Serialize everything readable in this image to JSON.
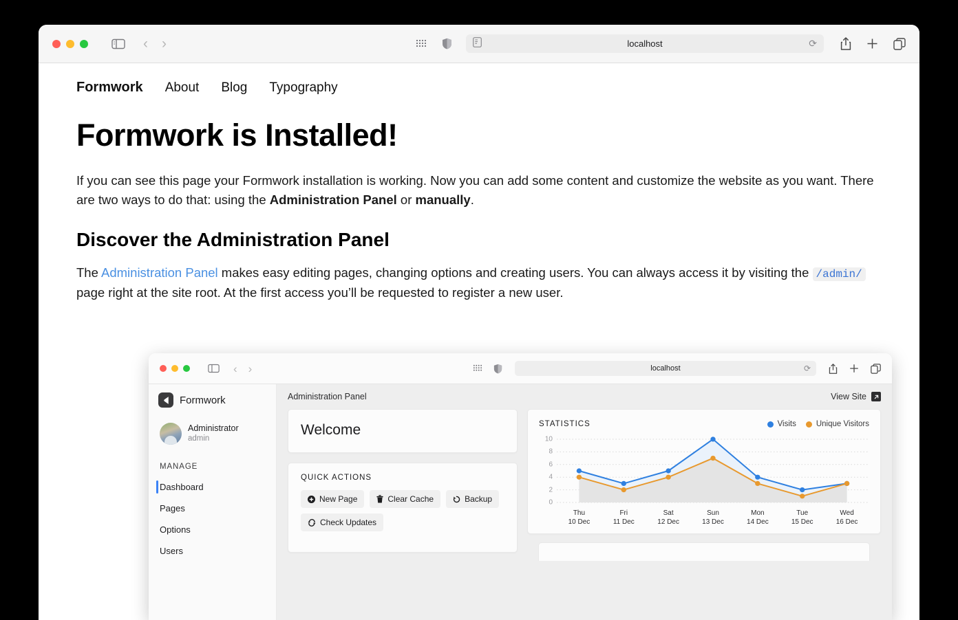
{
  "outer_browser": {
    "url": "localhost",
    "icons": {
      "sidebar": "sidebar-toggle-icon",
      "back": "‹",
      "forward": "›",
      "grid": "tab-grid-icon",
      "shield": "privacy-shield-icon",
      "reader": "reader-view-icon",
      "reload": "⟳",
      "share": "share-icon",
      "new_tab": "+",
      "tabs": "tab-overview-icon"
    }
  },
  "site_nav": {
    "brand": "Formwork",
    "items": [
      {
        "label": "About"
      },
      {
        "label": "Blog"
      },
      {
        "label": "Typography"
      }
    ]
  },
  "page": {
    "title": "Formwork is Installed!",
    "intro_part1": "If you can see this page your Formwork installation is working. Now you can add some content and customize the website as you want. There are two ways to do that: using the ",
    "intro_bold1": "Administration Panel",
    "intro_mid": " or ",
    "intro_bold2": "manually",
    "intro_end": ".",
    "section_title": "Discover the Administration Panel",
    "para2_start": "The ",
    "para2_link": "Administration Panel",
    "para2_mid": " makes easy editing pages, changing options and creating users. You can always access it by visiting the ",
    "para2_code": "/admin/",
    "para2_end": " page right at the site root. At the first access you’ll be requested to register a new user.",
    "link_color": "#4a90e2",
    "code_color": "#3b74d4"
  },
  "inner_browser": {
    "url": "localhost"
  },
  "admin": {
    "logo_text": "Formwork",
    "user": {
      "name": "Administrator",
      "handle": "admin"
    },
    "manage_label": "MANAGE",
    "nav": [
      {
        "label": "Dashboard",
        "active": true
      },
      {
        "label": "Pages",
        "active": false
      },
      {
        "label": "Options",
        "active": false
      },
      {
        "label": "Users",
        "active": false
      }
    ],
    "topbar": {
      "title": "Administration Panel",
      "view_site": "View Site",
      "view_site_icon": "external-link-icon"
    },
    "welcome": {
      "title": "Welcome"
    },
    "quick_actions": {
      "title": "QUICK ACTIONS",
      "buttons": [
        {
          "label": "New Page",
          "icon": "plus-circle-icon"
        },
        {
          "label": "Clear Cache",
          "icon": "trash-icon"
        },
        {
          "label": "Backup",
          "icon": "history-icon"
        },
        {
          "label": "Check Updates",
          "icon": "refresh-icon"
        }
      ]
    },
    "statistics": {
      "title": "STATISTICS"
    }
  },
  "chart_data": {
    "type": "line",
    "title": "STATISTICS",
    "xlabel": "",
    "ylabel": "",
    "ylim": [
      0,
      10
    ],
    "yticks": [
      0,
      2,
      4,
      6,
      8,
      10
    ],
    "grid": true,
    "legend_position": "top-right",
    "categories": [
      "Thu\n10 Dec",
      "Fri\n11 Dec",
      "Sat\n12 Dec",
      "Sun\n13 Dec",
      "Mon\n14 Dec",
      "Tue\n15 Dec",
      "Wed\n16 Dec"
    ],
    "x_day": [
      "Thu",
      "Fri",
      "Sat",
      "Sun",
      "Mon",
      "Tue",
      "Wed"
    ],
    "x_date": [
      "10 Dec",
      "11 Dec",
      "12 Dec",
      "13 Dec",
      "14 Dec",
      "15 Dec",
      "16 Dec"
    ],
    "series": [
      {
        "name": "Visits",
        "color": "#2f80e0",
        "values": [
          5,
          3,
          5,
          10,
          4,
          2,
          3
        ]
      },
      {
        "name": "Unique Visitors",
        "color": "#e8992e",
        "values": [
          4,
          2,
          4,
          7,
          3,
          1,
          3
        ]
      }
    ]
  }
}
